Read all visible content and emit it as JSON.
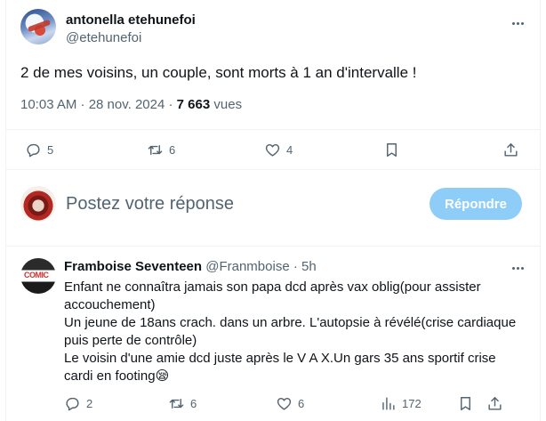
{
  "tweet": {
    "author_name": "antonella etehunefoi",
    "author_handle": "@etehunefoi",
    "text": "2 de mes voisins, un couple, sont morts à 1 an d'intervalle !",
    "time": "10:03 AM · 28 nov. 2024 · ",
    "views_count": "7 663",
    "views_label": " vues",
    "actions": {
      "replies": "5",
      "retweets": "6",
      "likes": "4"
    }
  },
  "compose": {
    "placeholder": "Postez votre réponse",
    "button_label": "Répondre",
    "button_color": "#8ecdf7"
  },
  "reply": {
    "author_name": "Framboise Seventeen",
    "author_handle": "@Franmboise",
    "time": "5h",
    "avatar_text": "COMIC",
    "lines": [
      "Enfant ne connaîtra jamais son papa dcd après vax oblig(pour assister accouchement)",
      "Un jeune de 18ans crach. dans un arbre. L'autopsie à révélé(crise cardiaque puis perte de contrôle)",
      "Le voisin d'une amie dcd juste après le V A X.Un gars 35 ans sportif crise cardi en footing😪"
    ],
    "actions": {
      "replies": "2",
      "retweets": "6",
      "likes": "6",
      "views": "172"
    }
  },
  "icons": [
    "more-icon",
    "reply-icon",
    "retweet-icon",
    "like-icon",
    "bookmark-icon",
    "share-icon",
    "views-icon"
  ]
}
